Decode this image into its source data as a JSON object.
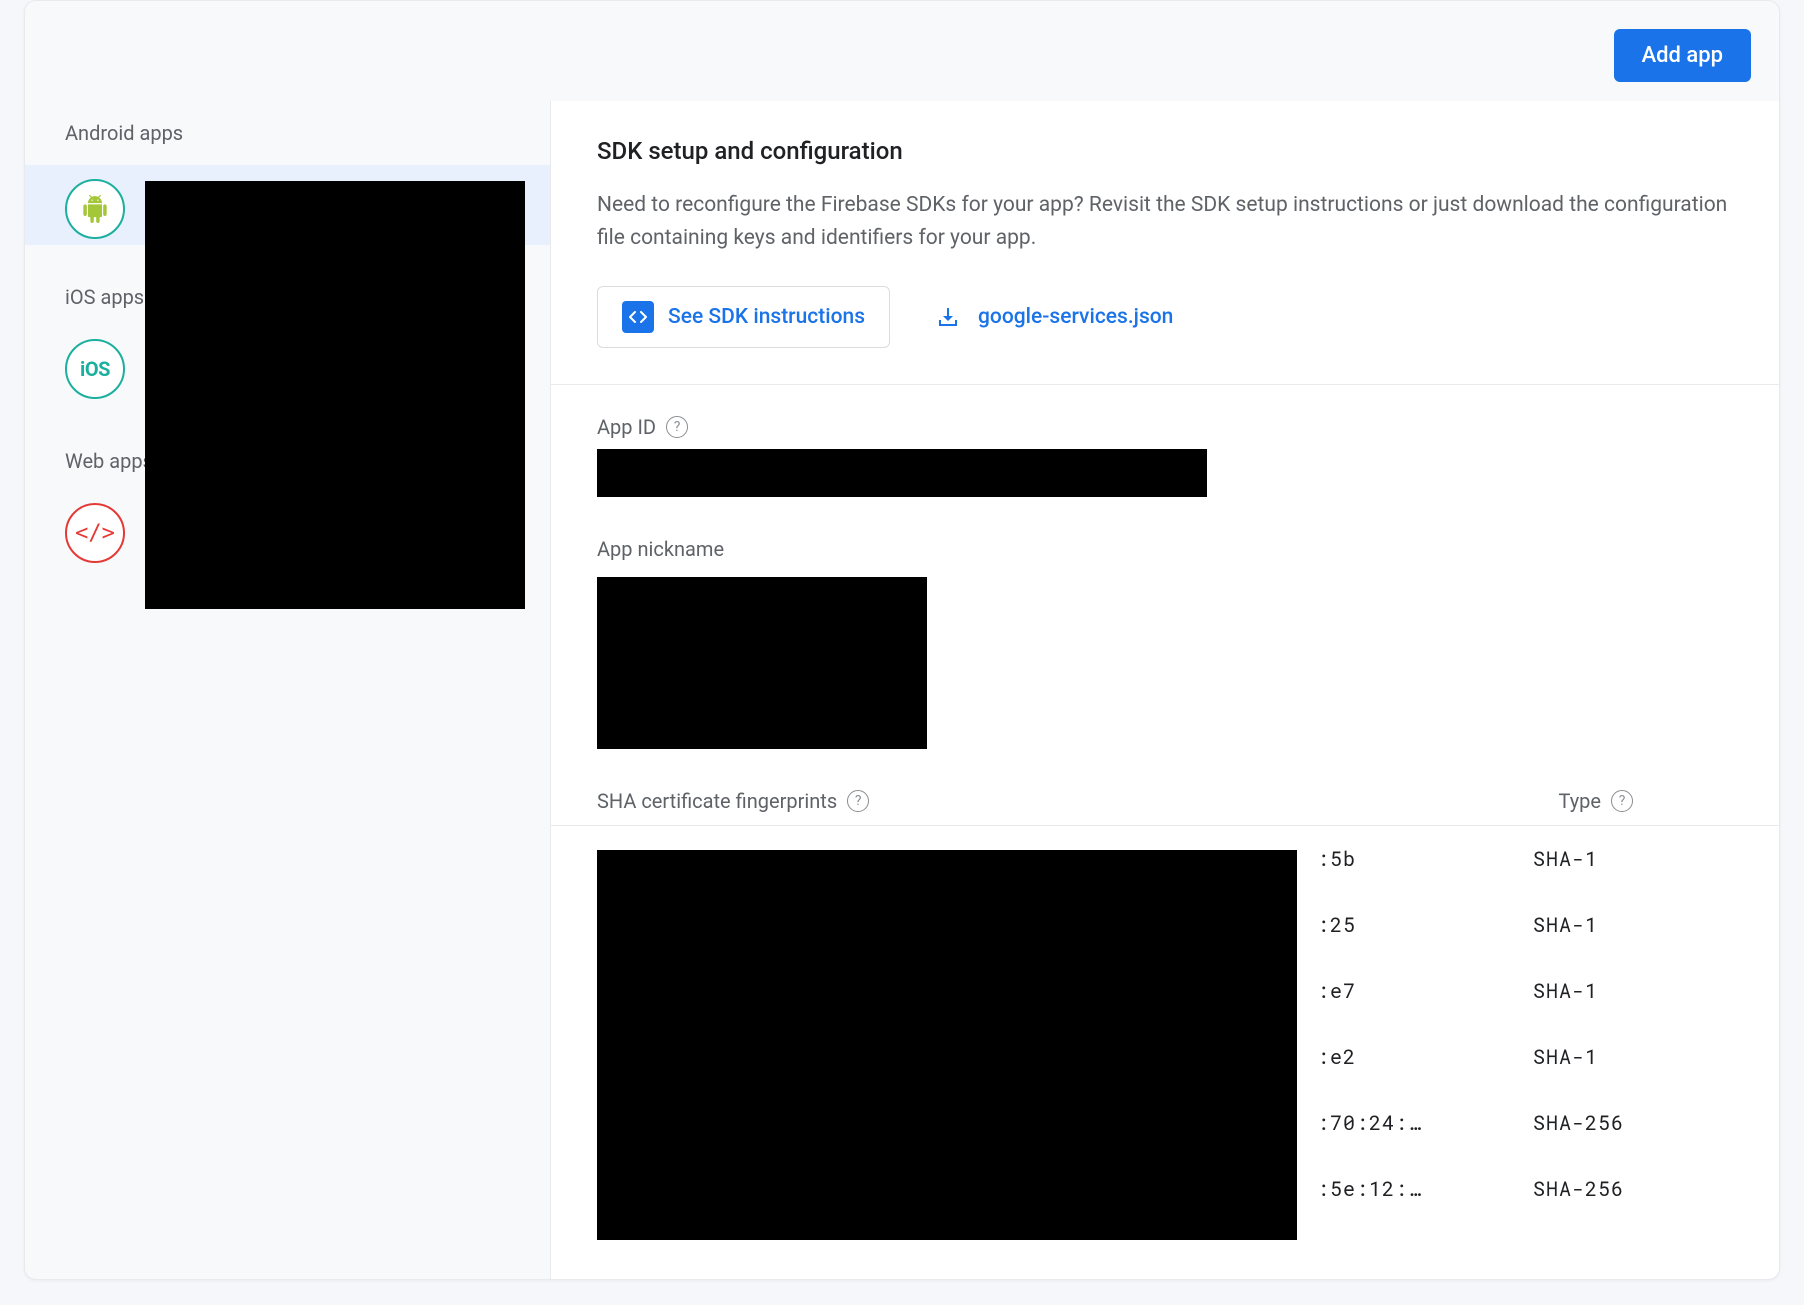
{
  "header": {
    "add_app_label": "Add app"
  },
  "sidebar": {
    "android_section_label": "Android apps",
    "ios_section_label": "iOS apps",
    "web_section_label": "Web apps",
    "ios_icon_text": "iOS",
    "web_icon_text": "</>"
  },
  "sdk": {
    "title": "SDK setup and configuration",
    "description": "Need to reconfigure the Firebase SDKs for your app? Revisit the SDK setup instructions or just download the configuration file containing keys and identifiers for your app.",
    "instructions_button": "See SDK instructions",
    "download_link": "google-services.json"
  },
  "fields": {
    "app_id_label": "App ID",
    "nickname_label": "App nickname",
    "sha_label": "SHA certificate fingerprints",
    "type_label": "Type"
  },
  "sha_rows": [
    {
      "fragment": ":5b",
      "type": "SHA-1"
    },
    {
      "fragment": ":25",
      "type": "SHA-1"
    },
    {
      "fragment": ":e7",
      "type": "SHA-1"
    },
    {
      "fragment": ":e2",
      "type": "SHA-1"
    },
    {
      "fragment": ":70:24:…",
      "type": "SHA-256"
    },
    {
      "fragment": ":5e:12:…",
      "type": "SHA-256"
    }
  ]
}
